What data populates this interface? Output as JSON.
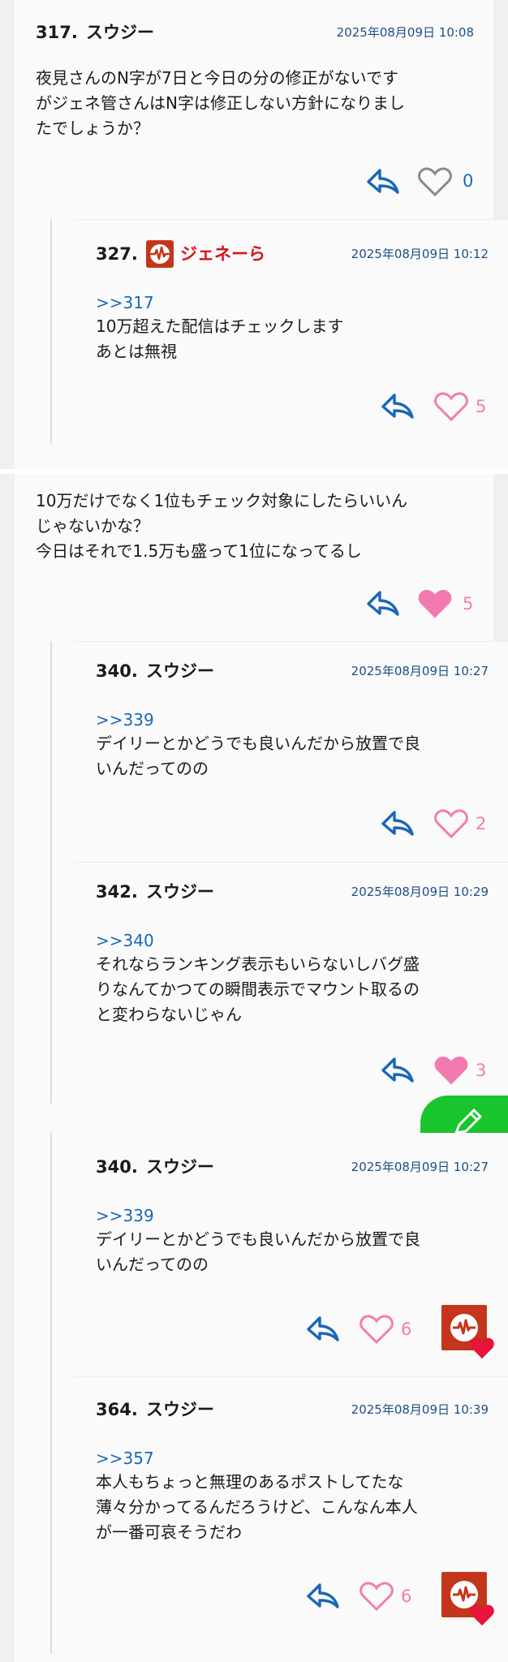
{
  "posts": [
    {
      "number": "317.",
      "author": "スウジー",
      "time": "2025年08月09日 10:08",
      "body": [
        "夜見さんのN字が7日と今日の分の修正がないです",
        "がジェネ管さんはN字は修正しない方針になりまし",
        "たでしょうか？"
      ],
      "likes": "0"
    },
    {
      "number": "327.",
      "author": "ジェネーら",
      "time": "2025年08月09日 10:12",
      "ref": ">>317",
      "body": [
        "10万超えた配信はチェックします",
        "あとは無視"
      ],
      "likes": "5"
    },
    {
      "body": [
        "10万だけでなく1位もチェック対象にしたらいいん",
        "じゃないかな？",
        "今日はそれで1.5万も盛って1位になってるし"
      ],
      "likes": "5"
    },
    {
      "number": "340.",
      "author": "スウジー",
      "time": "2025年08月09日 10:27",
      "ref": ">>339",
      "body": [
        "デイリーとかどうでも良いんだから放置で良",
        "いんだってのの"
      ],
      "likes": "2"
    },
    {
      "number": "342.",
      "author": "スウジー",
      "time": "2025年08月09日 10:29",
      "ref": ">>340",
      "body": [
        "それならランキング表示もいらないしバグ盛",
        "りなんてかつての瞬間表示でマウント取るの",
        "と変わらないじゃん"
      ],
      "likes": "3"
    },
    {
      "number": "340.",
      "author": "スウジー",
      "time": "2025年08月09日 10:27",
      "ref": ">>339",
      "body": [
        "デイリーとかどうでも良いんだから放置で良",
        "いんだってのの"
      ],
      "likes": "6"
    },
    {
      "number": "364.",
      "author": "スウジー",
      "time": "2025年08月09日 10:39",
      "ref": ">>357",
      "body": [
        "本人もちょっと無理のあるポストしてたな",
        "薄々分かってるんだろうけど、こんなん本人",
        "が一番可哀そうだわ"
      ],
      "likes": "6"
    }
  ],
  "colors": {
    "accent_blue": "#1a67b8",
    "timestamp": "#1d4f86",
    "like_pink": "#f27eab",
    "like_filled": "#f37ab0",
    "gray_heart": "#8a8a8a",
    "brand_red": "#c4361b",
    "gene_name_red": "#d8111c",
    "fab_green": "#18c52d"
  },
  "icons": {
    "reply": "reply-arrow-icon",
    "like": "heart-icon",
    "gene_badge": "pulse-badge-icon",
    "fab": "pencil-icon"
  }
}
